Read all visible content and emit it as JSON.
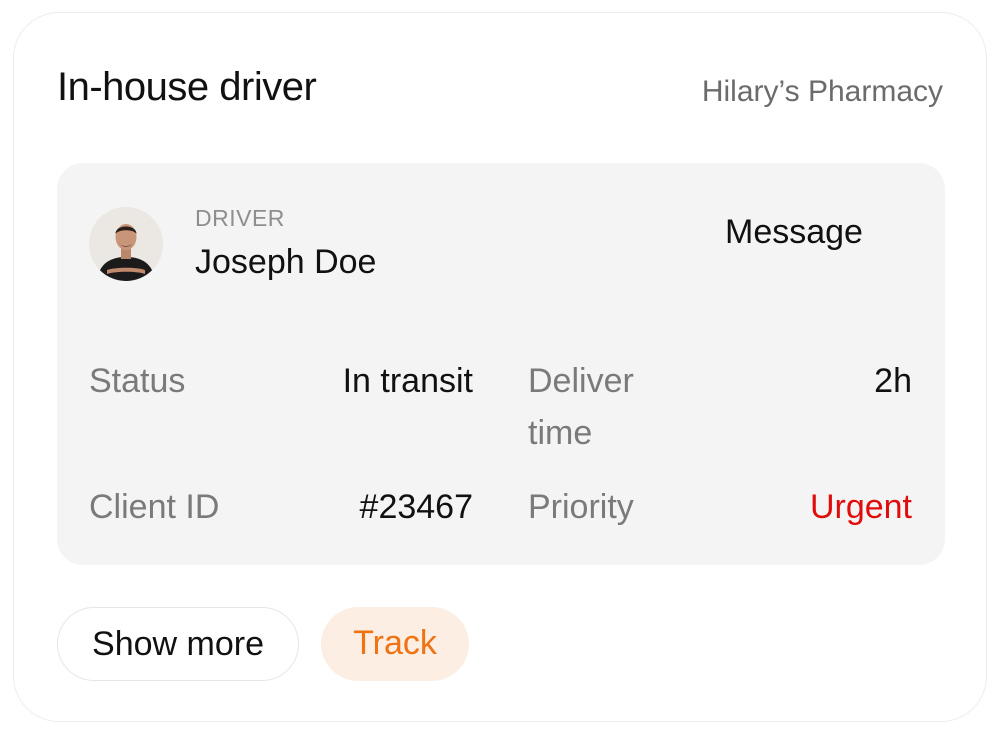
{
  "header": {
    "title": "In-house driver",
    "organization": "Hilary’s Pharmacy"
  },
  "driver": {
    "caption": "DRIVER",
    "name": "Joseph Doe",
    "message_label": "Message",
    "avatar_icon": "driver-avatar-photo"
  },
  "details": {
    "status_label": "Status",
    "status_value": "In transit",
    "deliver_label_line1": "Deliver",
    "deliver_label_line2": "time",
    "deliver_value": "2h",
    "client_label": "Client ID",
    "client_value": "#23467",
    "priority_label": "Priority",
    "priority_value": "Urgent"
  },
  "actions": {
    "show_more_label": "Show more",
    "track_label": "Track"
  },
  "colors": {
    "urgent": "#e00d0d",
    "track_text": "#f07313",
    "track_background": "#fdeee3",
    "panel_background": "#f4f4f4"
  }
}
